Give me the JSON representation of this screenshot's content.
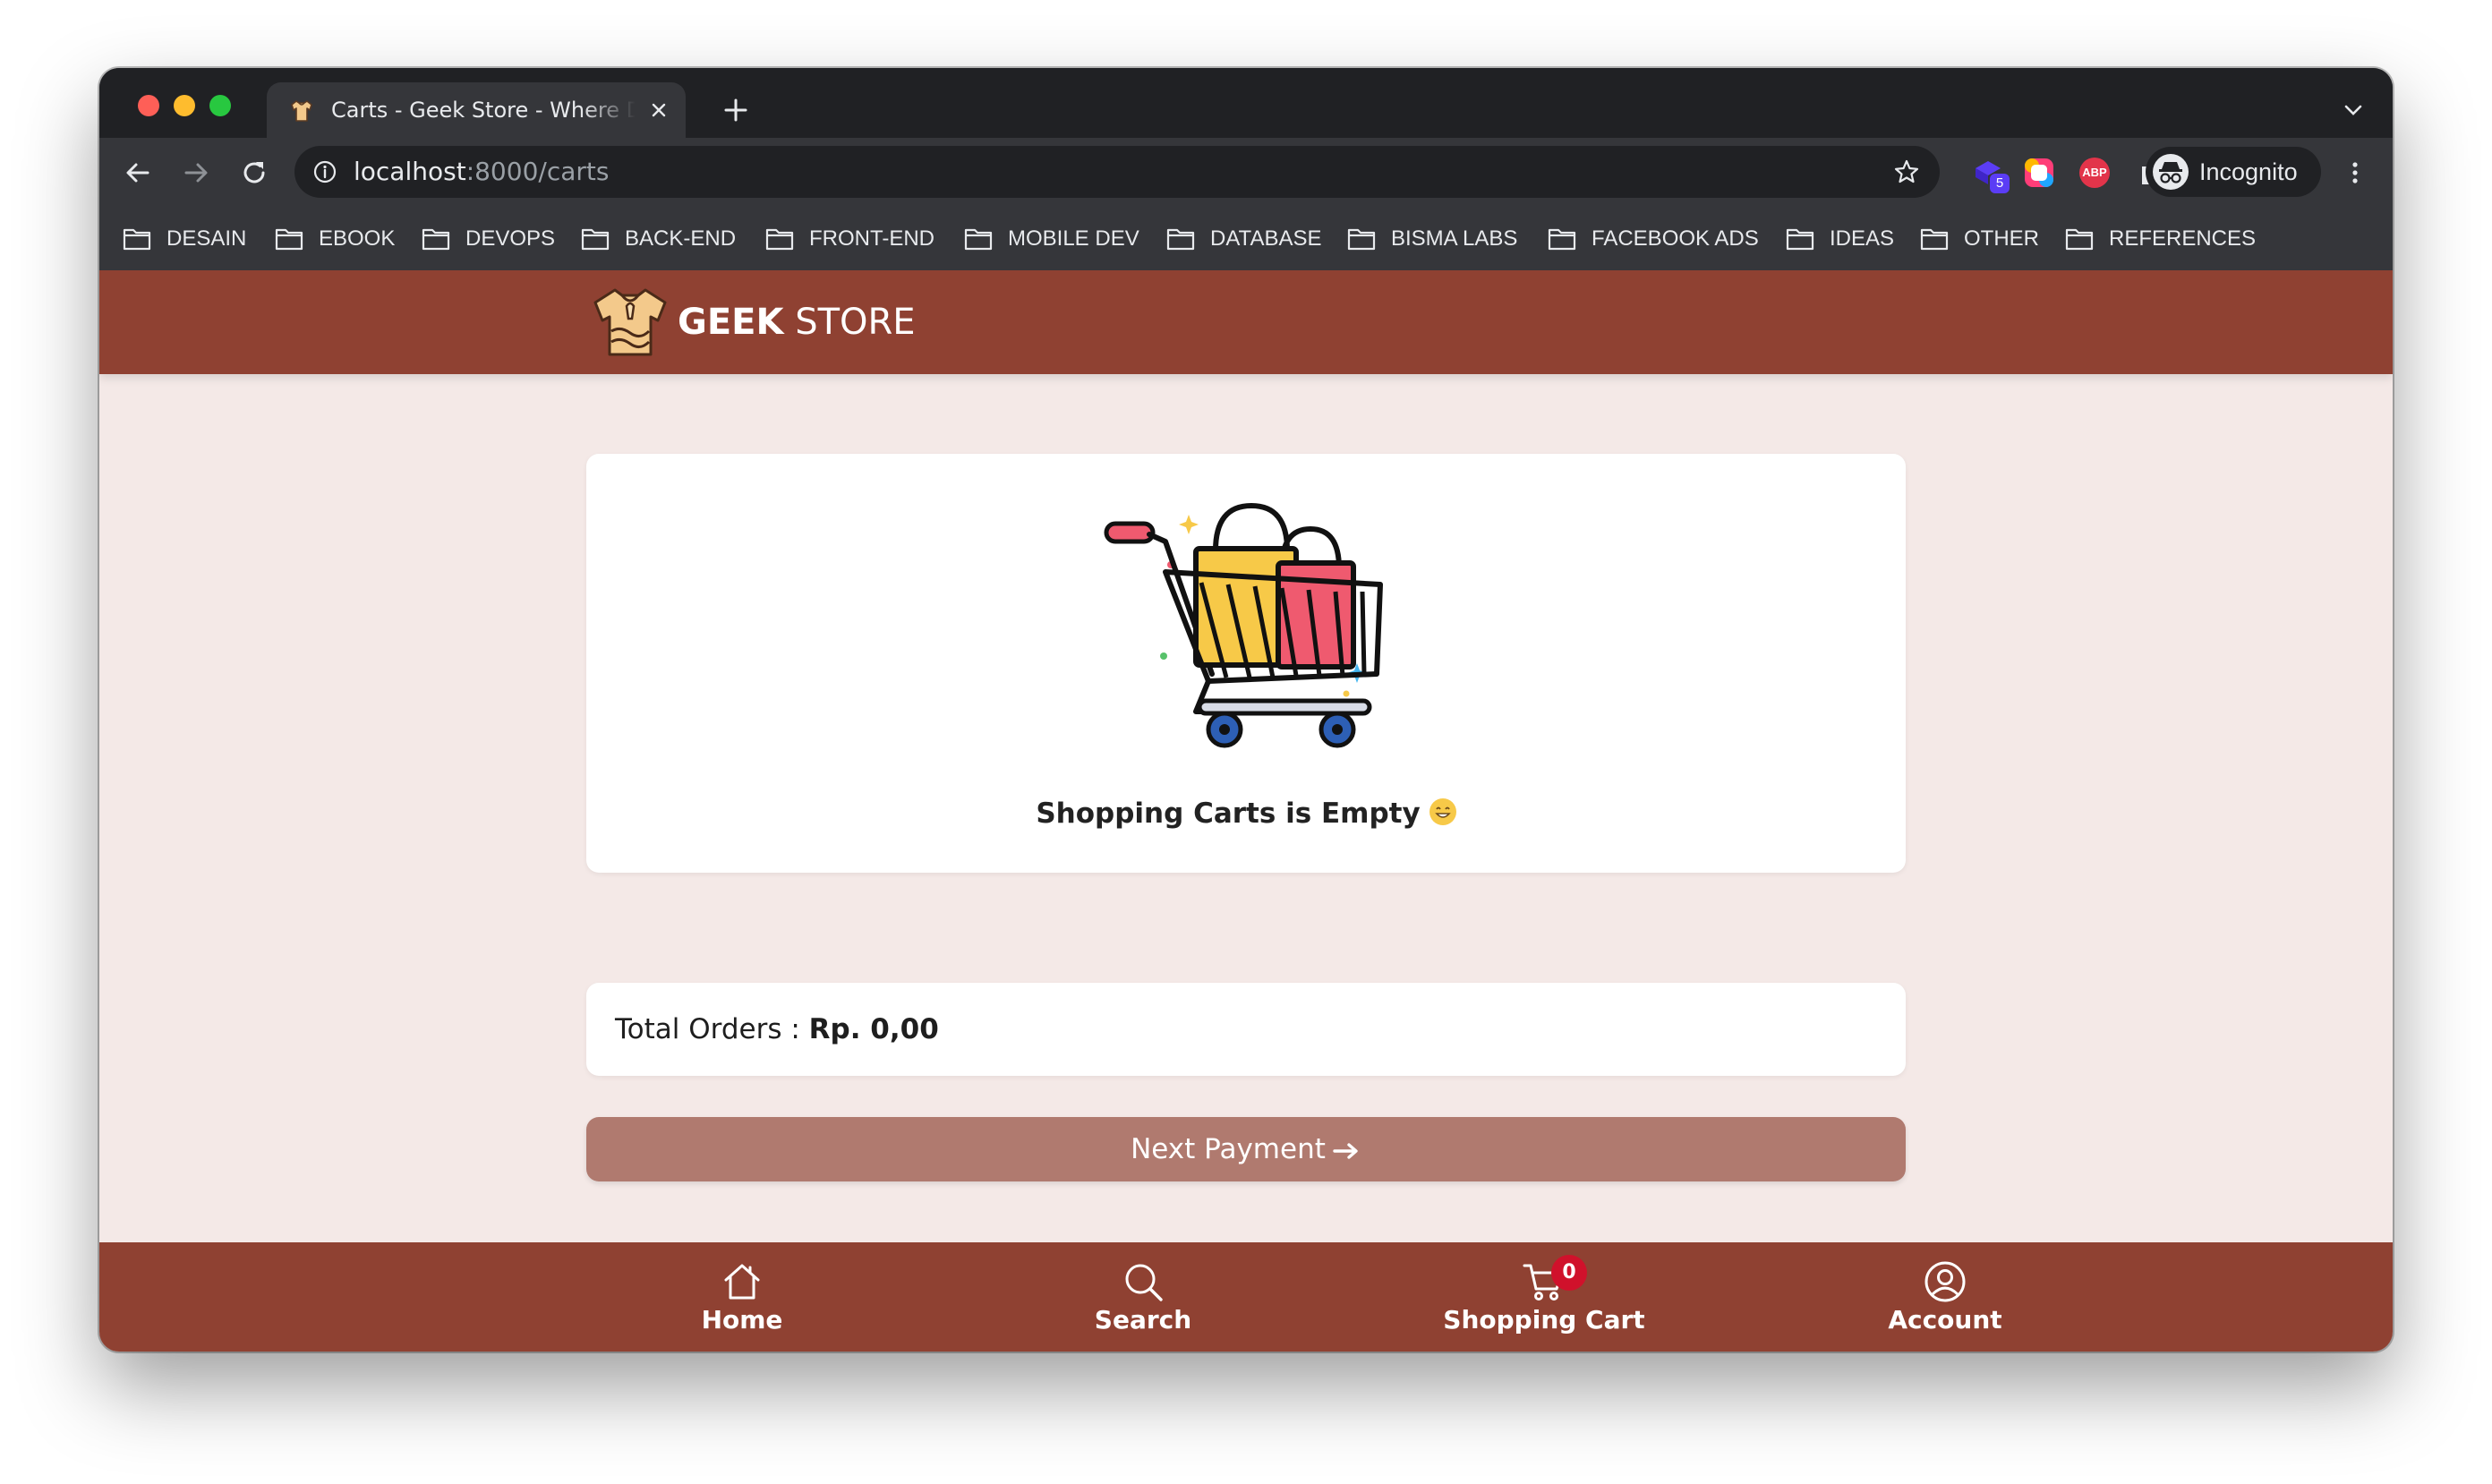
{
  "browser": {
    "tab": {
      "title": "Carts - Geek Store - Where Developer Shop"
    },
    "address_bar": {
      "host": "localhost",
      "rest": ":8000/carts"
    },
    "extensions": {
      "badge_count": "5",
      "abp_label": "ABP"
    },
    "profile": {
      "label": "Incognito"
    },
    "bookmarks": [
      "DESAIN",
      "EBOOK",
      "DEVOPS",
      "BACK-END",
      "FRONT-END",
      "MOBILE DEV",
      "DATABASE",
      "BISMA LABS",
      "FACEBOOK ADS",
      "IDEAS",
      "OTHER",
      "REFERENCES"
    ]
  },
  "site": {
    "brand": {
      "bold": "GEEK",
      "regular": "STORE"
    },
    "empty_cart": {
      "message": "Shopping Carts is Empty"
    },
    "total": {
      "label": "Total Orders :",
      "value": "Rp. 0,00"
    },
    "payment_button": {
      "label": "Next Payment"
    },
    "bottom_nav": {
      "home": "Home",
      "search": "Search",
      "cart": "Shopping Cart",
      "cart_count": "0",
      "account": "Account"
    }
  },
  "colors": {
    "brand": "#8f4132",
    "page_background": "#f4e9e7",
    "payment_button": "#b07a6f",
    "cart_badge": "#d0112b"
  },
  "icons": {
    "browser": [
      "back-icon",
      "forward-icon",
      "reload-icon",
      "info-icon",
      "star-icon",
      "extension-puzzle-icon",
      "side-panel-icon",
      "incognito-icon",
      "more-icon",
      "folder-icon",
      "new-tab-icon",
      "close-icon"
    ],
    "site": [
      "tshirt-logo-icon",
      "shopping-cart-illustration",
      "grinning-emoji-icon",
      "arrow-right-icon",
      "home-icon",
      "search-icon",
      "cart-icon",
      "account-icon"
    ]
  }
}
